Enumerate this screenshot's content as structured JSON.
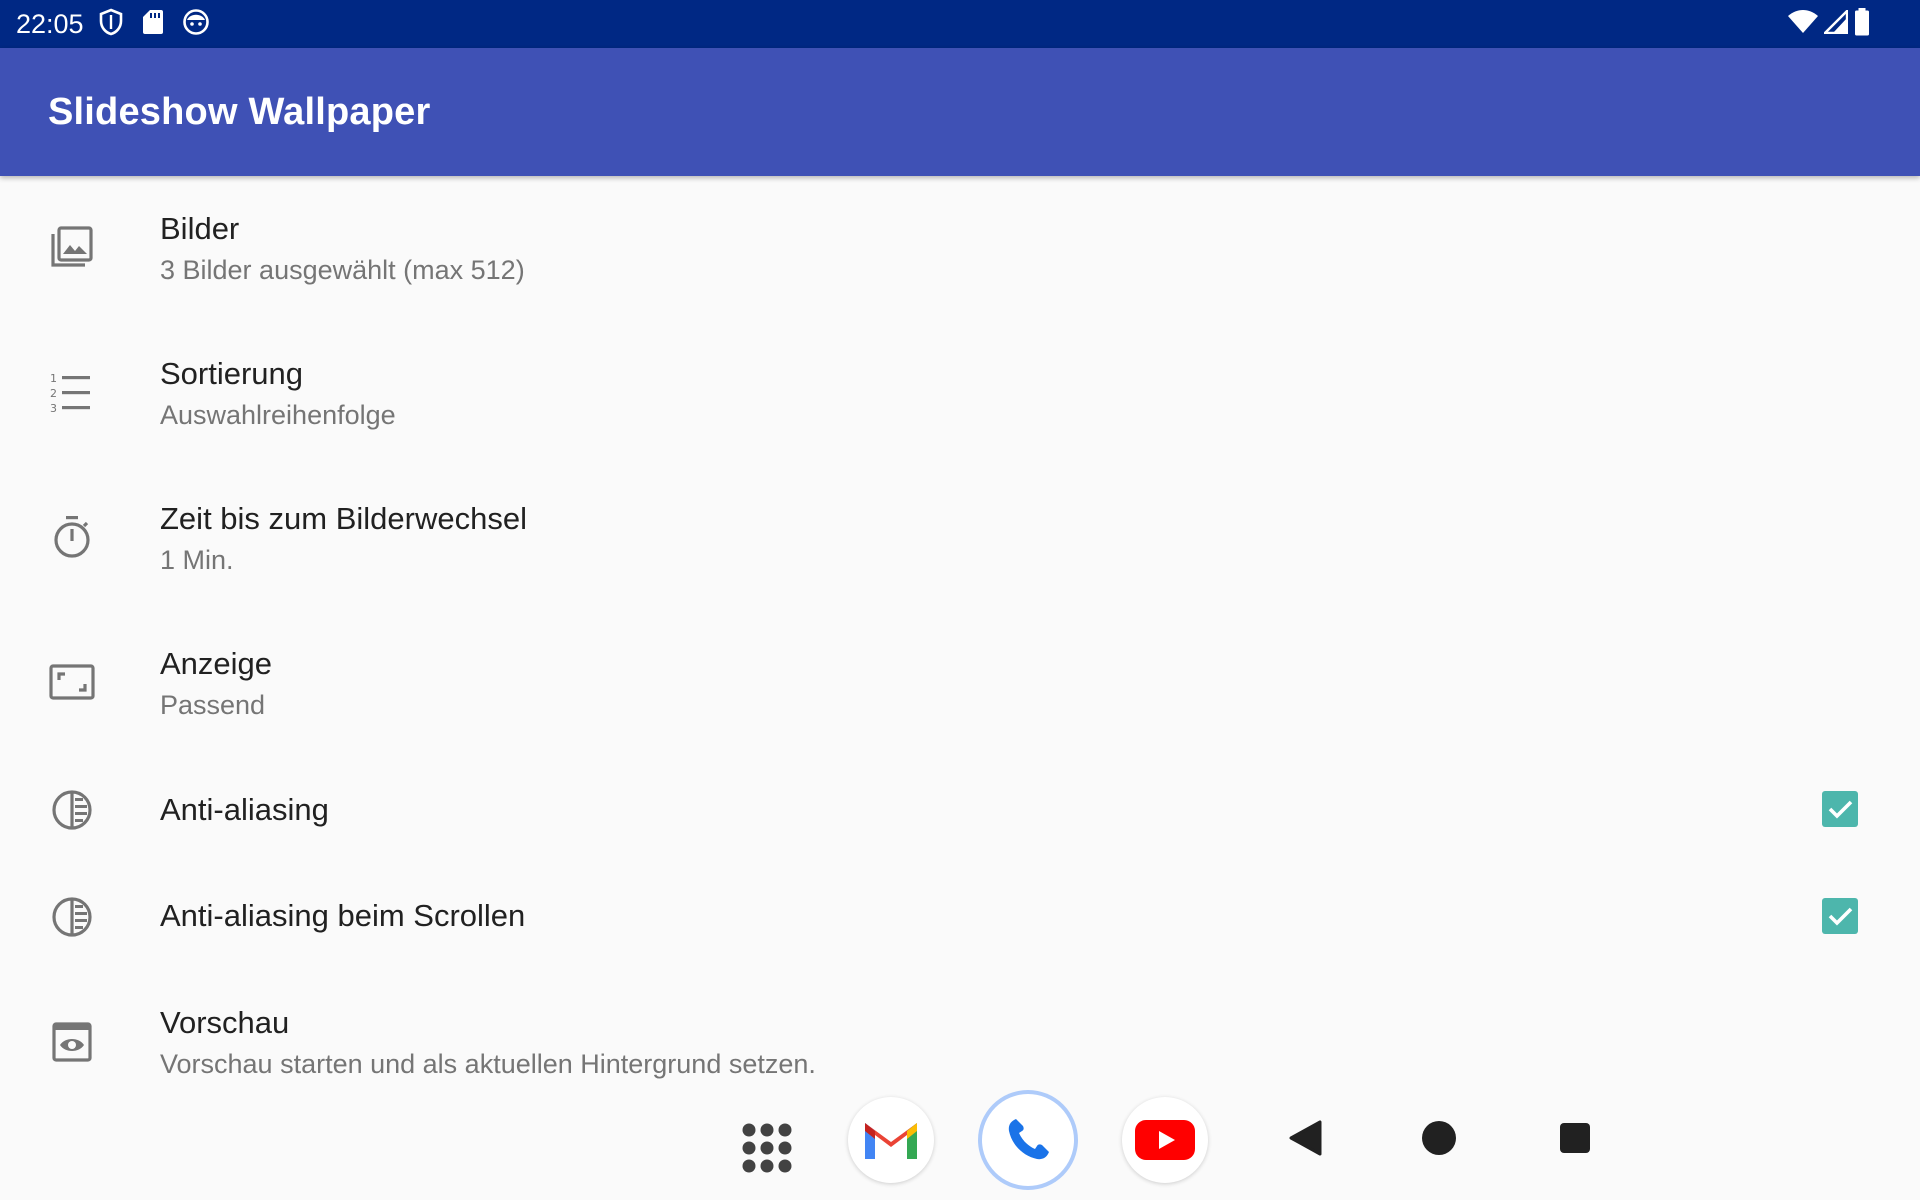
{
  "status_bar": {
    "time": "22:05",
    "left_icons": [
      "shield-icon",
      "sd-card-icon",
      "face-icon"
    ],
    "right_icons": [
      "wifi-icon",
      "cell-signal-icon",
      "battery-icon"
    ],
    "background": "#002884"
  },
  "app_bar": {
    "title": "Slideshow Wallpaper",
    "background": "#3f51b5"
  },
  "preferences": [
    {
      "icon": "image-library-icon",
      "title": "Bilder",
      "summary": "3 Bilder ausgewählt (max 512)"
    },
    {
      "icon": "numbered-list-icon",
      "title": "Sortierung",
      "summary": "Auswahlreihenfolge"
    },
    {
      "icon": "timer-icon",
      "title": "Zeit bis zum Bilderwechsel",
      "summary": "1 Min."
    },
    {
      "icon": "aspect-ratio-icon",
      "title": "Anzeige",
      "summary": "Passend"
    },
    {
      "icon": "gradient-icon",
      "title": "Anti-aliasing",
      "checked": true
    },
    {
      "icon": "gradient-icon",
      "title": "Anti-aliasing beim Scrollen",
      "checked": true
    },
    {
      "icon": "preview-icon",
      "title": "Vorschau",
      "summary": "Vorschau starten und als aktuellen Hintergrund setzen."
    }
  ],
  "accent_color": "#4db6ac",
  "nav_bar": {
    "items": [
      "app-drawer-icon",
      "gmail-icon",
      "phone-icon",
      "youtube-icon",
      "back-icon",
      "home-icon",
      "recents-icon"
    ]
  }
}
